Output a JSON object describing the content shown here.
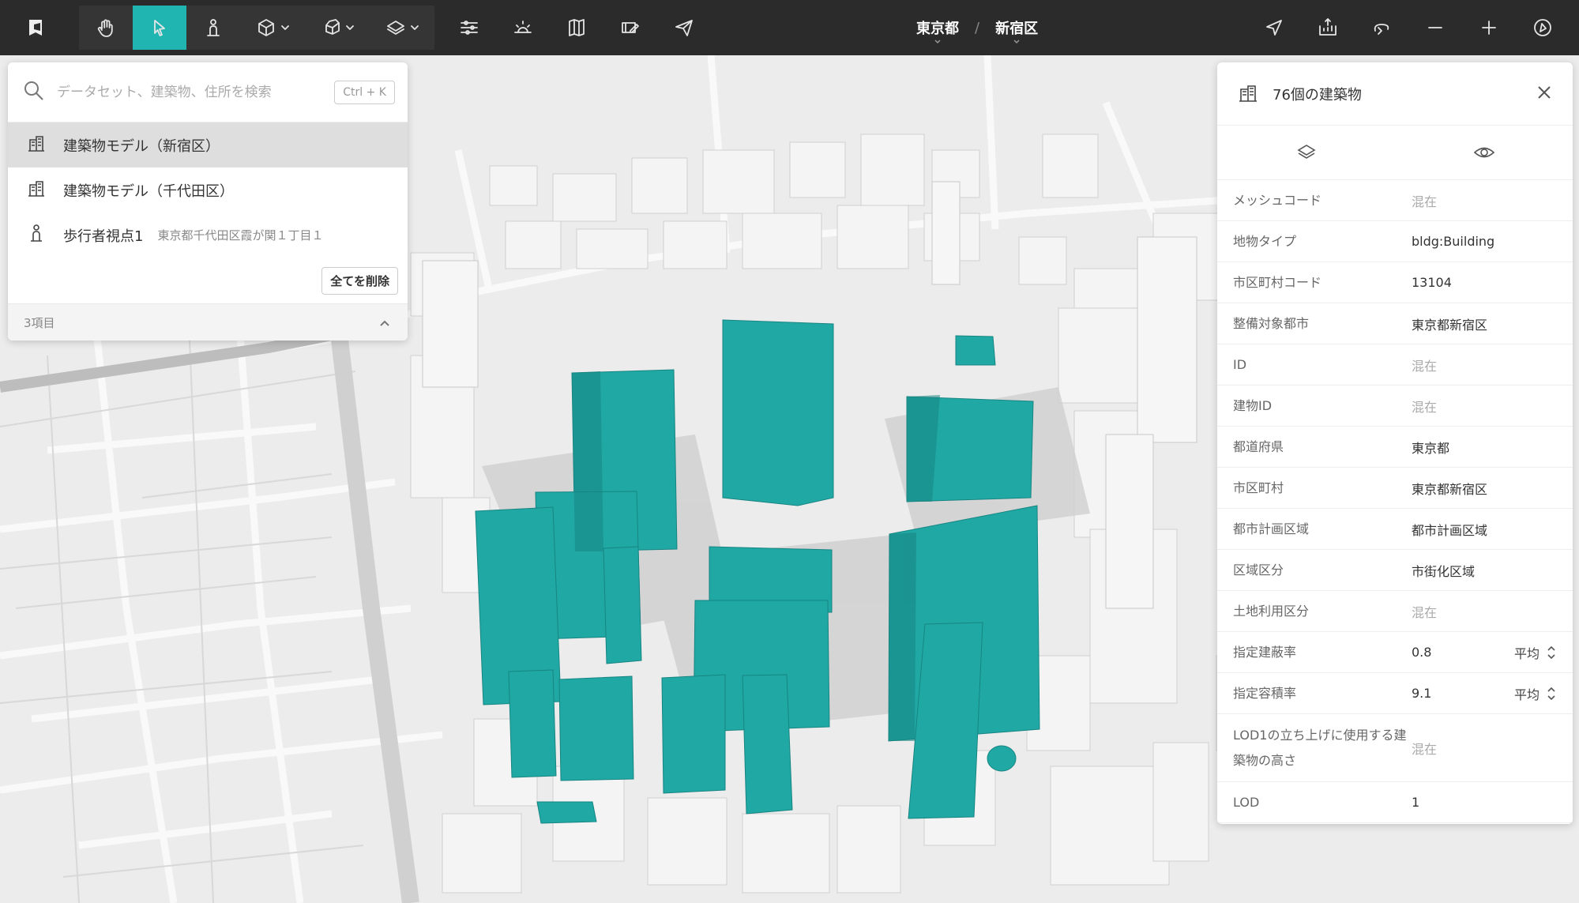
{
  "toolbar": {
    "logo": "app-logo",
    "tools": [
      {
        "name": "hand-icon"
      },
      {
        "name": "select-arrow-icon"
      },
      {
        "name": "pedestrian-icon"
      },
      {
        "name": "cube-icon"
      },
      {
        "name": "extrude-icon"
      },
      {
        "name": "layers-icon"
      }
    ],
    "active_tool_color": "#21b5b1",
    "breadcrumb": [
      "東京都",
      "新宿区"
    ],
    "breadcrumb_separator": "/"
  },
  "search": {
    "placeholder": "データセット、建築物、住所を検索",
    "shortcut": "Ctrl + K",
    "results": [
      {
        "label": "建築物モデル（新宿区）",
        "sub": ""
      },
      {
        "label": "建築物モデル（千代田区）",
        "sub": ""
      },
      {
        "label": "歩行者視点1",
        "sub": "東京都千代田区霞が関１丁目１"
      }
    ],
    "clear_label": "全てを削除",
    "count_label": "3項目"
  },
  "properties": {
    "title": "76個の建築物",
    "rows": [
      {
        "key": "メッシュコード",
        "value": "混在",
        "muted": true
      },
      {
        "key": "地物タイプ",
        "value": "bldg:Building",
        "muted": false
      },
      {
        "key": "市区町村コード",
        "value": "13104",
        "muted": false
      },
      {
        "key": "整備対象都市",
        "value": "東京都新宿区",
        "muted": false
      },
      {
        "key": "ID",
        "value": "混在",
        "muted": true
      },
      {
        "key": "建物ID",
        "value": "混在",
        "muted": true
      },
      {
        "key": "都道府県",
        "value": "東京都",
        "muted": false
      },
      {
        "key": "市区町村",
        "value": "東京都新宿区",
        "muted": false
      },
      {
        "key": "都市計画区域",
        "value": "都市計画区域",
        "muted": false
      },
      {
        "key": "区域区分",
        "value": "市街化区域",
        "muted": false
      },
      {
        "key": "土地利用区分",
        "value": "混在",
        "muted": true
      },
      {
        "key": "指定建蔽率",
        "value": "0.8",
        "muted": false,
        "agg": "平均"
      },
      {
        "key": "指定容積率",
        "value": "9.1",
        "muted": false,
        "agg": "平均"
      },
      {
        "key": "LOD1の立ち上げに使用する建築物の高さ",
        "value": "混在",
        "muted": true
      },
      {
        "key": "LOD",
        "value": "1",
        "muted": false
      }
    ]
  },
  "map": {
    "highlight_color": "#20a8a4",
    "background_color": "#ececec"
  }
}
